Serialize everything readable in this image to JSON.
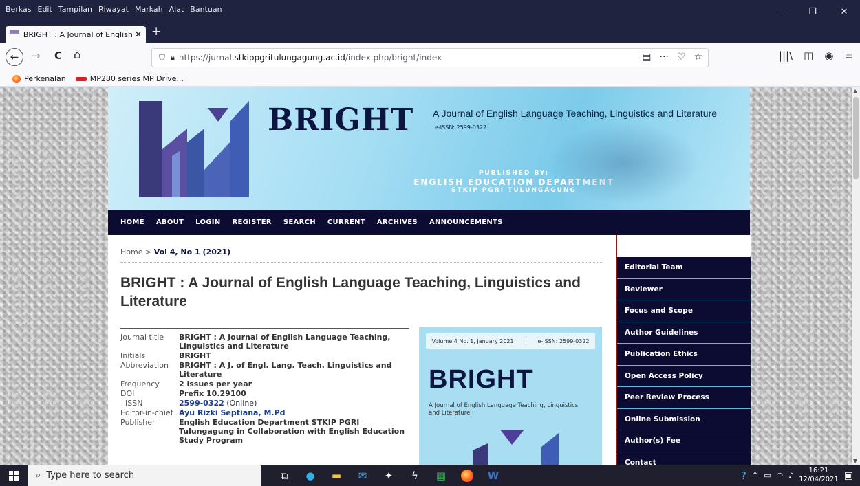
{
  "window": {
    "menu": [
      "Berkas",
      "Edit",
      "Tampilan",
      "Riwayat",
      "Markah",
      "Alat",
      "Bantuan"
    ],
    "controls": {
      "minimize": "–",
      "restore": "❐",
      "close": "✕"
    }
  },
  "tab": {
    "title": "BRIGHT : A Journal of English L",
    "close": "✕",
    "new": "+"
  },
  "toolbar": {
    "back": "←",
    "forward": "→",
    "reload": "C",
    "home": "⌂",
    "url_prefix": "https://jurnal.",
    "url_domain": "stkippgritulungagung.ac.id",
    "url_path": "/index.php/bright/index",
    "reader": "▤",
    "more": "···",
    "pocket": "♡",
    "star": "☆",
    "library": "|||\\",
    "sidebar": "◫",
    "account": "◉",
    "menu": "≡"
  },
  "bookmarks": [
    {
      "label": "Perkenalan"
    },
    {
      "label": "MP280 series MP Drive..."
    }
  ],
  "banner": {
    "name": "BRIGHT",
    "subtitle": "A Journal of English Language Teaching, Linguistics and Literature",
    "issn": "e-ISSN: 2599-0322",
    "published_by": "PUBLISHED BY:",
    "department": "ENGLISH EDUCATION DEPARTMENT",
    "institution": "STKIP PGRI TULUNGAGUNG"
  },
  "nav": [
    "HOME",
    "ABOUT",
    "LOGIN",
    "REGISTER",
    "SEARCH",
    "CURRENT",
    "ARCHIVES",
    "ANNOUNCEMENTS"
  ],
  "breadcrumb": {
    "home": "Home",
    "sep": " > ",
    "current": "Vol 4, No 1 (2021)"
  },
  "page_title": "BRIGHT : A Journal of English Language Teaching, Linguistics and Literature",
  "info": {
    "journal_title_k": "Journal title",
    "journal_title_v": "BRIGHT : A Journal of English Language Teaching, Linguistics and Literature",
    "initials_k": "Initials",
    "initials_v": "BRIGHT",
    "abbreviation_k": "Abbreviation",
    "abbreviation_v": "BRIGHT : A J. of Engl. Lang. Teach. Linguistics and Literature",
    "frequency_k": "Frequency",
    "frequency_v": "2 issues per year",
    "doi_k": "DOI",
    "doi_v": "Prefix 10.29100",
    "issn_k": "ISSN",
    "issn_v": "2599-0322",
    "issn_note": " (Online)",
    "editor_k": "Editor-in-chief",
    "editor_v": "Ayu Rizki Septiana, M.Pd",
    "publisher_k": "Publisher",
    "publisher_v": "English Education Department STKIP PGRI Tulungagung in Collaboration with English Education Study Program"
  },
  "cover": {
    "volume": "Volume 4 No. 1, January 2021",
    "issn": "e-ISSN: 2599-0322",
    "title": "BRIGHT",
    "subtitle": "A Journal of English Language Teaching, Linguistics and Literature"
  },
  "sidebar": [
    "Editorial Team",
    "Reviewer",
    "Focus and Scope",
    "Author Guidelines",
    "Publication Ethics",
    "Open Access Policy",
    "Peer Review Process",
    "Online Submission",
    "Author(s) Fee",
    "Contact"
  ],
  "taskbar": {
    "search_placeholder": "Type here to search",
    "time": "16:21",
    "date": "12/04/2021"
  },
  "colors": {
    "nav_bg": "#0c0c33",
    "accent_blue": "#1d3f8a",
    "banner": "#a6def4"
  }
}
